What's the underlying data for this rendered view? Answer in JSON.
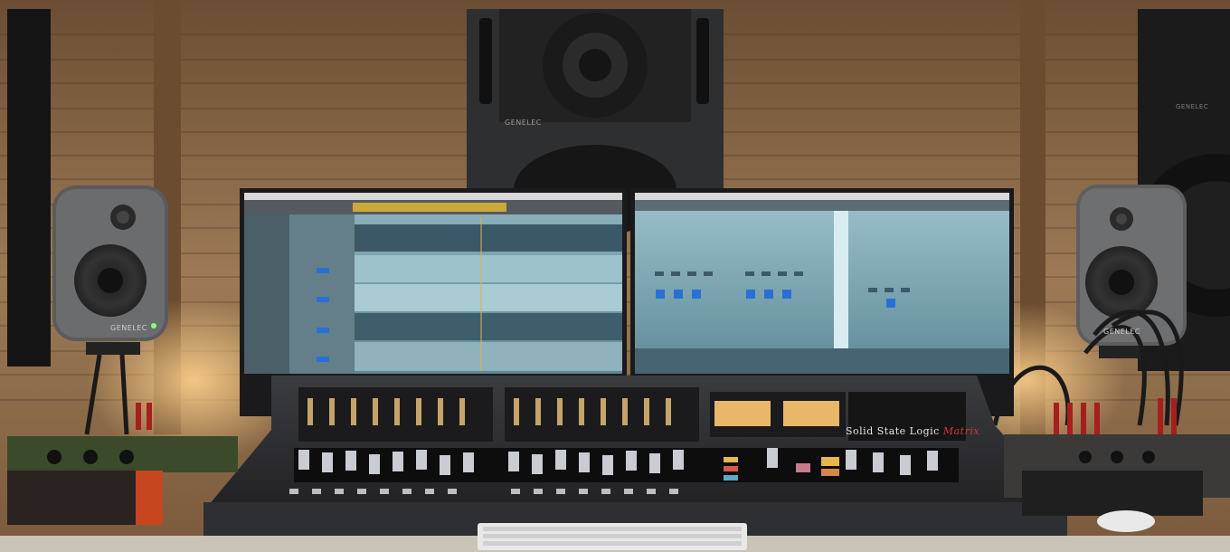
{
  "scene": {
    "description_tags": [
      "music-studio",
      "mixing-console",
      "studio-monitors",
      "daw-screens",
      "wood-wall"
    ]
  },
  "branding": {
    "console_brand": "Solid State Logic",
    "console_model": "Matrix",
    "monitor_top": "GENELEC",
    "monitor_left": "GENELEC",
    "monitor_right": "GENELEC",
    "monitor_right_large": "GENELEC"
  },
  "colors": {
    "wood": "#8a6a48",
    "wood_dark": "#5e432b",
    "speaker": "#3b3c3e",
    "console": "#2a2b2e",
    "screen": "#7fa6b5",
    "warm_light": "#f5c27a"
  }
}
